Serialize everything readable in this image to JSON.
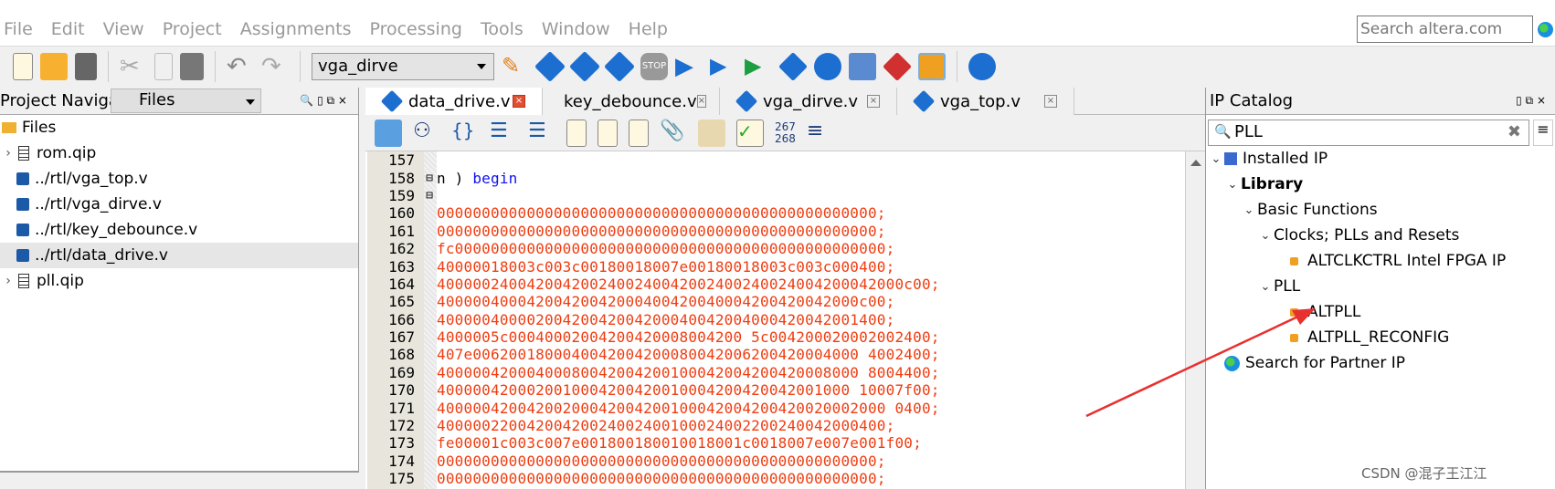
{
  "menu": [
    "File",
    "Edit",
    "View",
    "Project",
    "Assignments",
    "Processing",
    "Tools",
    "Window",
    "Help"
  ],
  "search_web_placeholder": "Search altera.com",
  "toolbar": {
    "revision": "vga_dirve"
  },
  "navigator": {
    "title": "Project Navigator",
    "view": "Files",
    "items": [
      {
        "label": "Files",
        "type": "folder"
      },
      {
        "label": "rom.qip",
        "type": "qip",
        "expand": true
      },
      {
        "label": "../rtl/vga_top.v",
        "type": "v"
      },
      {
        "label": "../rtl/vga_dirve.v",
        "type": "v"
      },
      {
        "label": "../rtl/key_debounce.v",
        "type": "v"
      },
      {
        "label": "../rtl/data_drive.v",
        "type": "v",
        "selected": true
      },
      {
        "label": "pll.qip",
        "type": "qip",
        "expand": true
      }
    ]
  },
  "editor": {
    "tabs": [
      {
        "label": "data_drive.v",
        "active": true
      },
      {
        "label": "key_debounce.v"
      },
      {
        "label": "vga_dirve.v"
      },
      {
        "label": "vga_top.v"
      }
    ],
    "toolbar_line_numbers": [
      "267",
      "268"
    ],
    "lines": [
      {
        "n": "157",
        "t": ""
      },
      {
        "n": "158",
        "t": "n ) ",
        "kw": "begin",
        "fold": true
      },
      {
        "n": "159",
        "t": "",
        "fold": true
      },
      {
        "n": "160",
        "t": "0000000000000000000000000000000000000000000000000;"
      },
      {
        "n": "161",
        "t": "0000000000000000000000000000000000000000000000000;"
      },
      {
        "n": "162",
        "t": "fc000000000000000000000000000000000000000000000000;"
      },
      {
        "n": "163",
        "t": "40000018003c003c00180018007e00180018003c003c000400;"
      },
      {
        "n": "164",
        "t": "4000002400420042002400240042002400240024004200042000c00;"
      },
      {
        "n": "165",
        "t": "40000040004200420042000400420040004200420042000c00;"
      },
      {
        "n": "166",
        "t": "40000040000200420042004200040042004000420042001400;"
      },
      {
        "n": "167",
        "t": "4000005c00040002004200420008004200 5c004200020002002400;"
      },
      {
        "n": "168",
        "t": "407e0062001800040042004200080042006200420004000 4002400;"
      },
      {
        "n": "169",
        "t": "40000042000400080042004200100042004200420008000 8004400;"
      },
      {
        "n": "170",
        "t": "4000004200020010004200420010004200420042001000 10007f00;"
      },
      {
        "n": "171",
        "t": "40000042004200200042004200100042004200420020002000 0400;"
      },
      {
        "n": "172",
        "t": "40000022004200420024002400100024002200240042000400;"
      },
      {
        "n": "173",
        "t": "fe00001c003c007e001800180010018001c0018007e007e001f00;"
      },
      {
        "n": "174",
        "t": "0000000000000000000000000000000000000000000000000;"
      },
      {
        "n": "175",
        "t": "0000000000000000000000000000000000000000000000000;"
      }
    ]
  },
  "ip_catalog": {
    "title": "IP Catalog",
    "search": "PLL",
    "tree": [
      {
        "label": "Installed IP",
        "level": 0,
        "icon": "ip"
      },
      {
        "label": "Library",
        "level": 1,
        "bold": true
      },
      {
        "label": "Basic Functions",
        "level": 2
      },
      {
        "label": "Clocks; PLLs and Resets",
        "level": 3
      },
      {
        "label": "ALTCLKCTRL Intel FPGA IP",
        "level": 4,
        "leaf": true
      },
      {
        "label": "PLL",
        "level": 3
      },
      {
        "label": "ALTPLL",
        "level": 4,
        "leaf": true
      },
      {
        "label": "ALTPLL_RECONFIG",
        "level": 4,
        "leaf": true
      },
      {
        "label": "Search for Partner IP",
        "level": 0,
        "icon": "globe"
      }
    ]
  },
  "watermark": "CSDN @混子王江江",
  "colors": {
    "code_literal": "#f03c10",
    "keyword": "#1010f0",
    "annotation_arrow": "#e83030"
  }
}
